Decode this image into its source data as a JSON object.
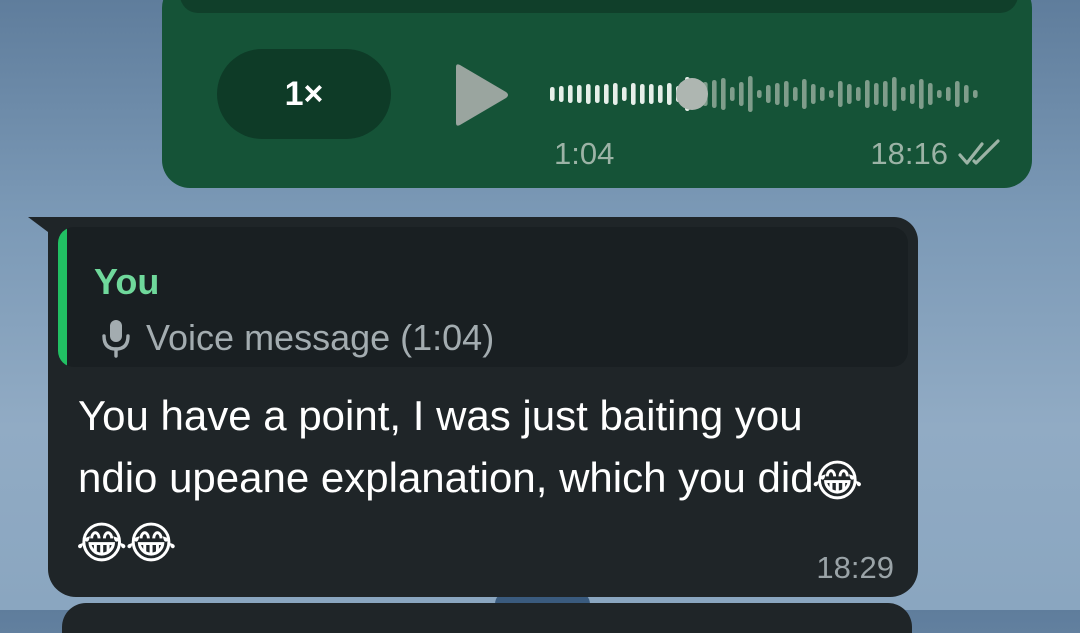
{
  "outgoing_voice": {
    "speed_label": "1×",
    "duration": "1:04",
    "time": "18:16",
    "status": "read",
    "progress": 0.33,
    "icons": [
      "play-icon",
      "double-check-icon"
    ]
  },
  "reply": {
    "quoted_sender": "You",
    "quoted_preview": "Voice message (1:04)",
    "quoted_icon": "microphone-icon",
    "text_main": "You have a point, I was just baiting you ndio upeane explanation, which you did",
    "emojis": [
      "😂",
      "😂",
      "😂"
    ],
    "time": "18:29"
  },
  "colors": {
    "outgoing_bubble": "#155337",
    "incoming_bubble": "#1f2528",
    "quote_accent": "#21c063",
    "quote_sender": "#6fd89b",
    "wallpaper": "#7b99b6"
  }
}
